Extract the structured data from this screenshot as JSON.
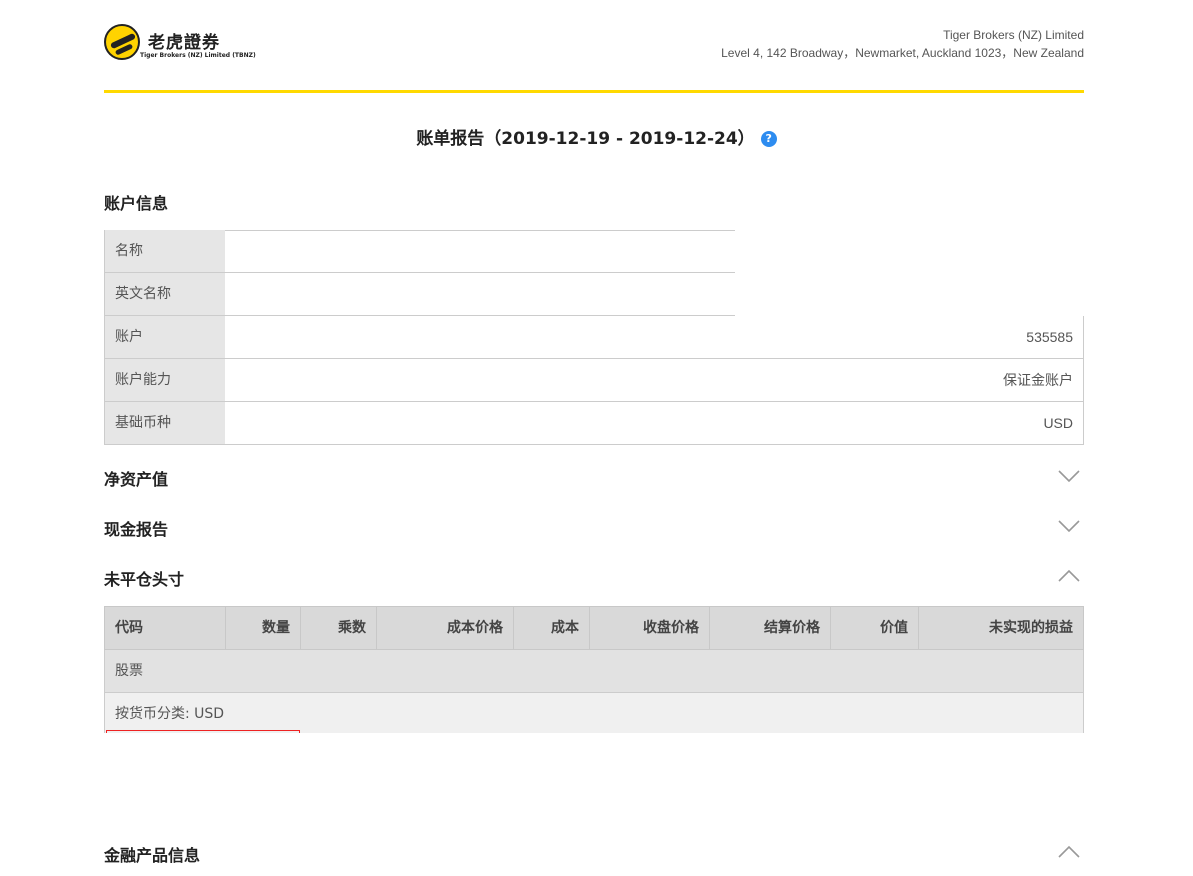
{
  "header": {
    "logo_text": "老虎證券",
    "logo_sub": "Tiger Brokers (NZ) Limited (TBNZ)",
    "company_name": "Tiger Brokers (NZ) Limited",
    "company_address": "Level 4, 142 Broadway，Newmarket, Auckland 1023，New Zealand"
  },
  "report": {
    "title": "账单报告（2019-12-19 - 2019-12-24）",
    "help_icon": "?"
  },
  "account_info": {
    "title": "账户信息",
    "rows": [
      {
        "label": "名称",
        "value": ""
      },
      {
        "label": "英文名称",
        "value": ""
      },
      {
        "label": "账户",
        "value": "535585"
      },
      {
        "label": "账户能力",
        "value": "保证金账户"
      },
      {
        "label": "基础币种",
        "value": "USD"
      }
    ]
  },
  "sections": {
    "net_asset": "净资产值",
    "cash_report": "现金报告",
    "open_positions": "未平仓头寸",
    "financial_info": "金融产品信息"
  },
  "positions": {
    "columns": [
      "代码",
      "数量",
      "乘数",
      "成本价格",
      "成本",
      "收盘价格",
      "结算价格",
      "价值",
      "未实现的损益"
    ],
    "group": "股票",
    "subgroup": "按货币分类: USD"
  },
  "colors": {
    "accent": "#ffd900",
    "help_icon": "#2d8cf0"
  }
}
